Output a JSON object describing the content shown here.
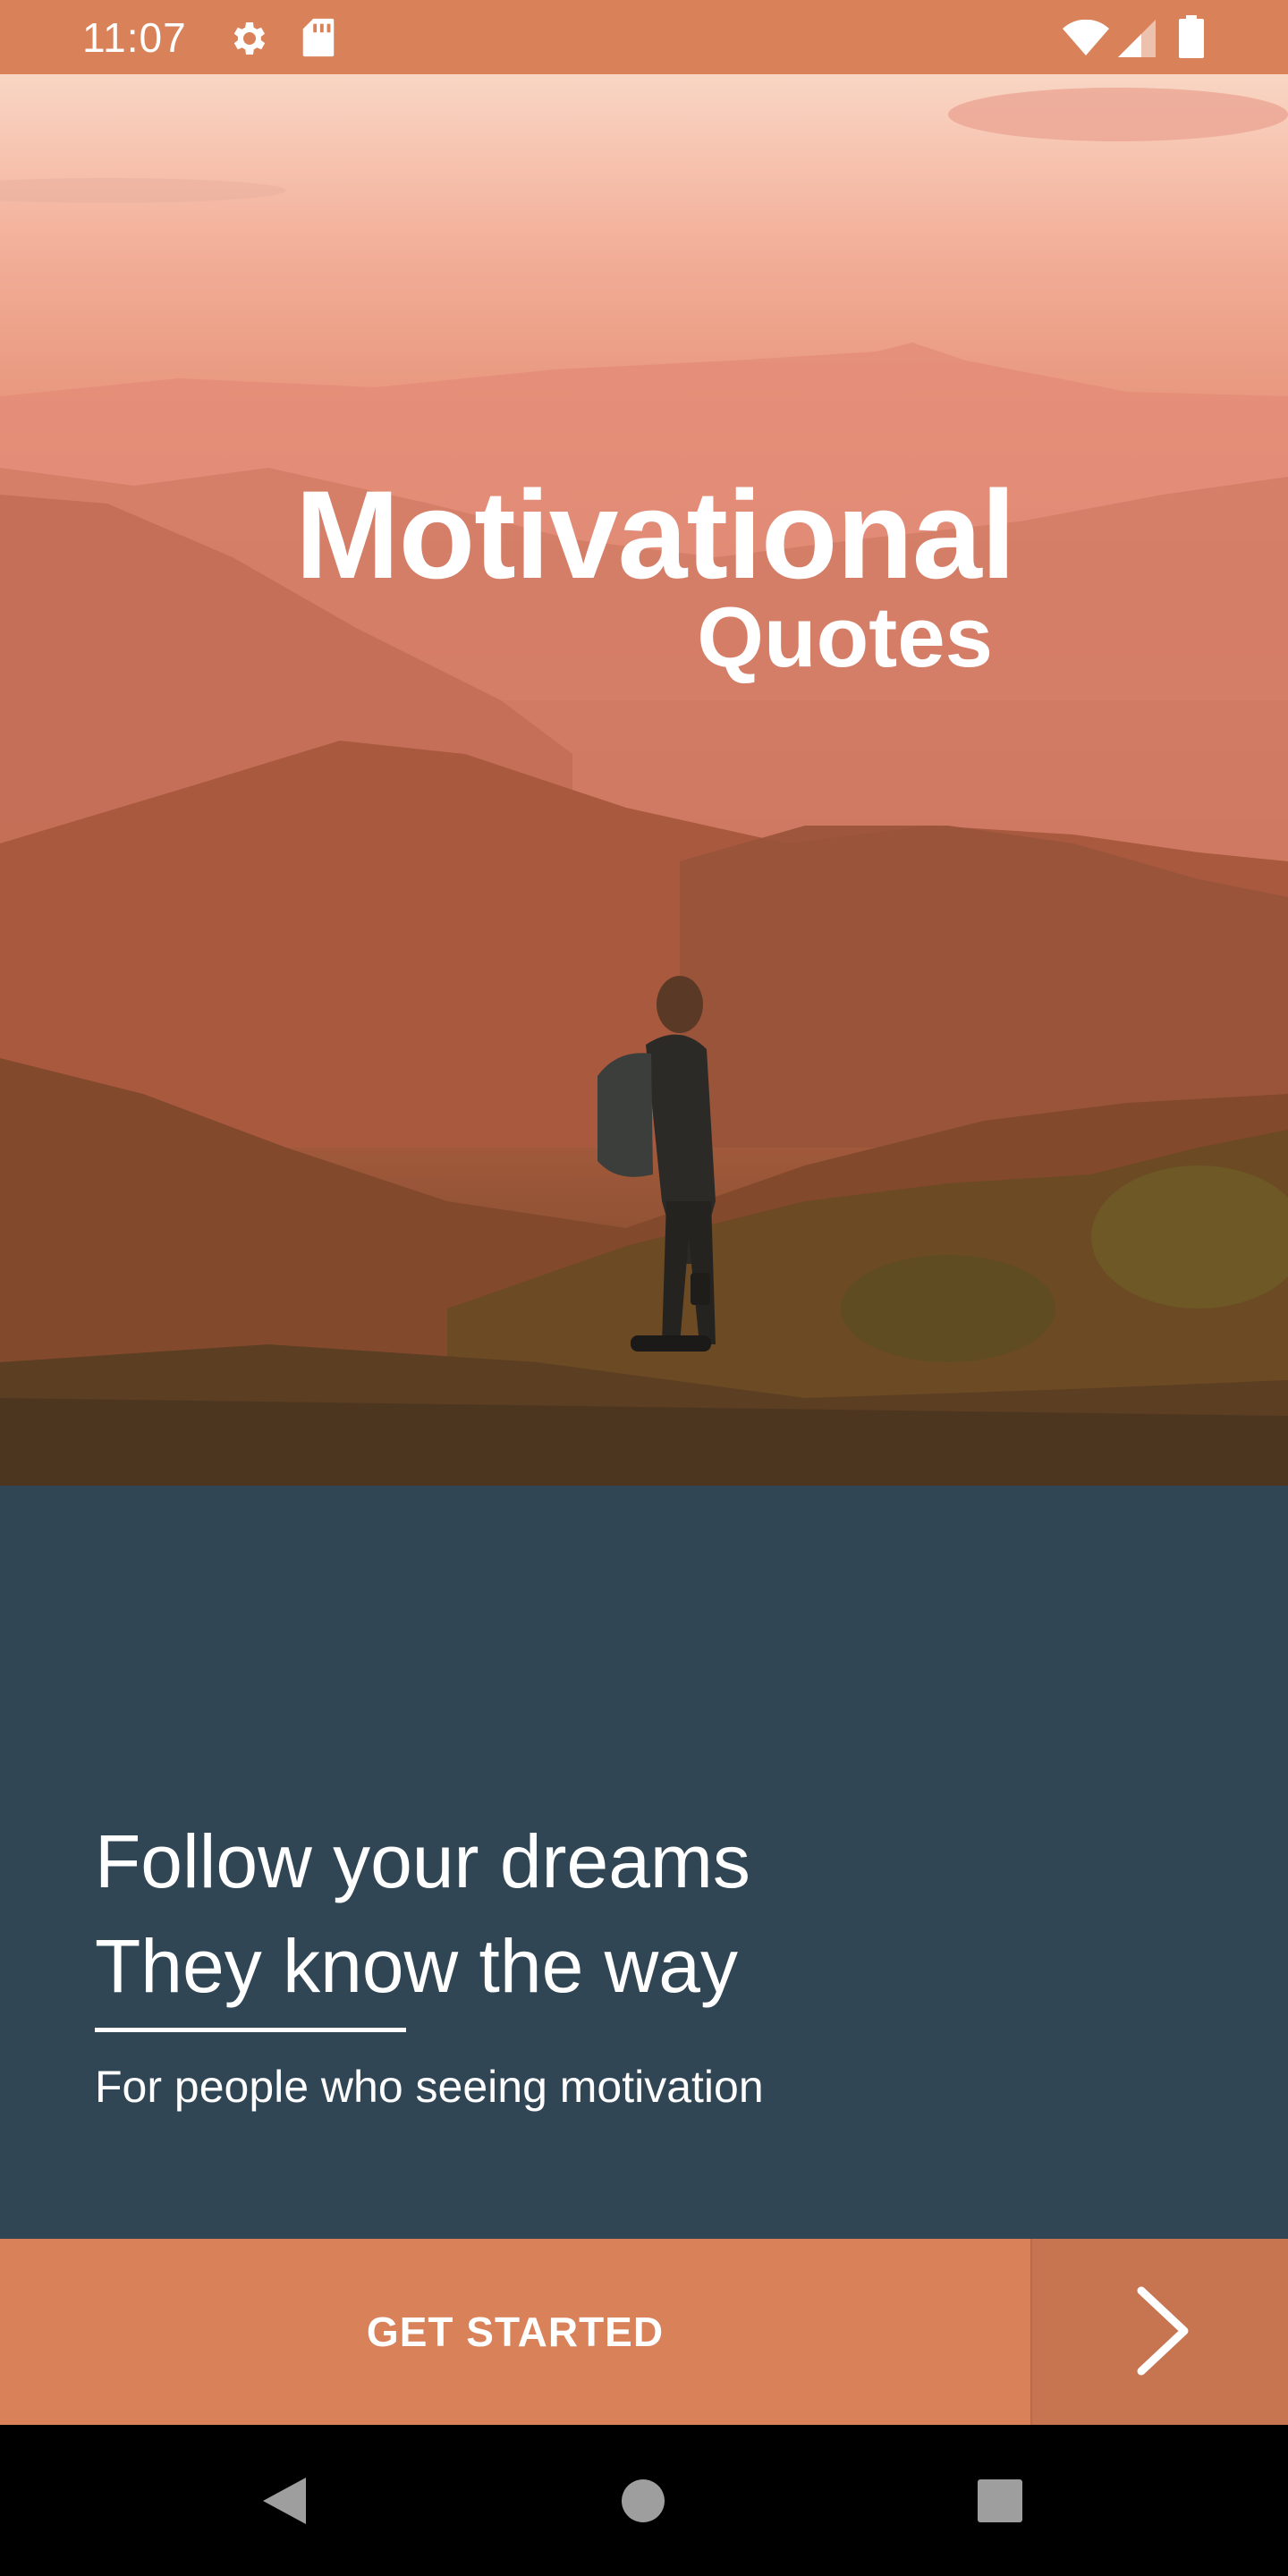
{
  "status_bar": {
    "time": "11:07",
    "icons": [
      "gear-icon",
      "sd-card-icon",
      "wifi-icon",
      "cell-signal-icon",
      "battery-icon"
    ]
  },
  "hero": {
    "title": "Motivational",
    "subtitle": "Quotes",
    "image": "mountain-sunset-hiker-photo"
  },
  "panel": {
    "headline_line1": "Follow your dreams",
    "headline_line2": "They know the way",
    "tagline": "For people who seeing motivation"
  },
  "actions": {
    "get_started_label": "GET STARTED",
    "next_icon": "chevron-right-icon"
  },
  "nav_bar": {
    "buttons": [
      "back-icon",
      "home-icon",
      "recents-icon"
    ]
  },
  "colors": {
    "accent": "#d9825a",
    "accent_dark": "#c77451",
    "panel": "#314655",
    "nav": "#000000"
  }
}
